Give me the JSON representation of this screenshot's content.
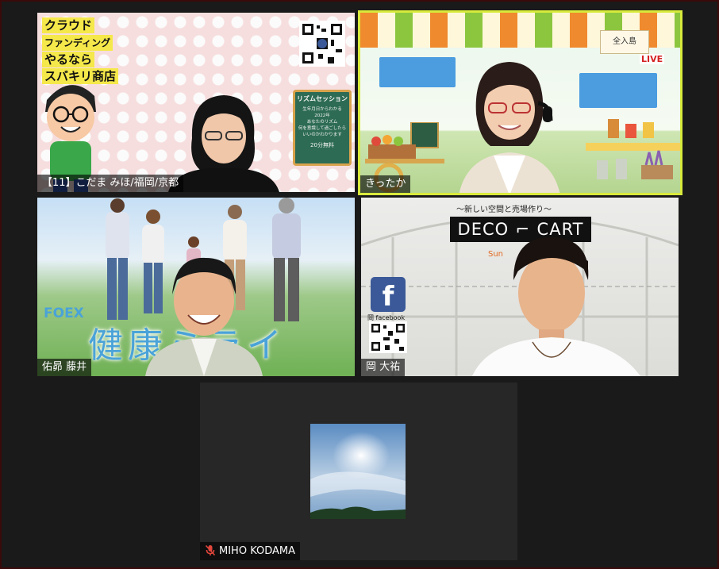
{
  "participants": [
    {
      "id": "t1",
      "name": "【11】こだま みほ/福岡/京都",
      "poster": {
        "title_lines": [
          "クラウド",
          "ファンディング",
          "やるなら",
          "スバキリ商店"
        ],
        "sign_title": "リズムセッション",
        "sign_lines": [
          "生年月日からわかる",
          "2022年",
          "あなたのリズム",
          "何を意識して過ごしたら",
          "いいのかわかります"
        ],
        "sign_free": "20分無料"
      }
    },
    {
      "id": "t2",
      "name": "きったか",
      "active_speaker": true,
      "poster": {
        "live_badge": "LIVE",
        "sign_board": "全入島"
      }
    },
    {
      "id": "t3",
      "name": "佑昴 藤井",
      "poster": {
        "logo": "FOEX",
        "slogan": "健康ミライ"
      }
    },
    {
      "id": "t4",
      "name": "岡 大祐",
      "poster": {
        "tagline": "～新しい空間と売場作り～",
        "logo_left": "DECO",
        "logo_right": "CART",
        "company": "Sun",
        "facebook_letter": "f",
        "facebook_caption": "岡 facebook"
      }
    },
    {
      "id": "t5",
      "name": "MIHO KODAMA",
      "muted": true,
      "video_off": true
    }
  ],
  "colors": {
    "background": "#1a1a1a",
    "active_border": "#d8ea3c",
    "muted_icon": "#e0463c",
    "facebook_blue": "#3b5998"
  },
  "icons": {
    "muted": "microphone-muted-icon",
    "facebook": "facebook-icon",
    "qr": "qr-code-icon"
  }
}
